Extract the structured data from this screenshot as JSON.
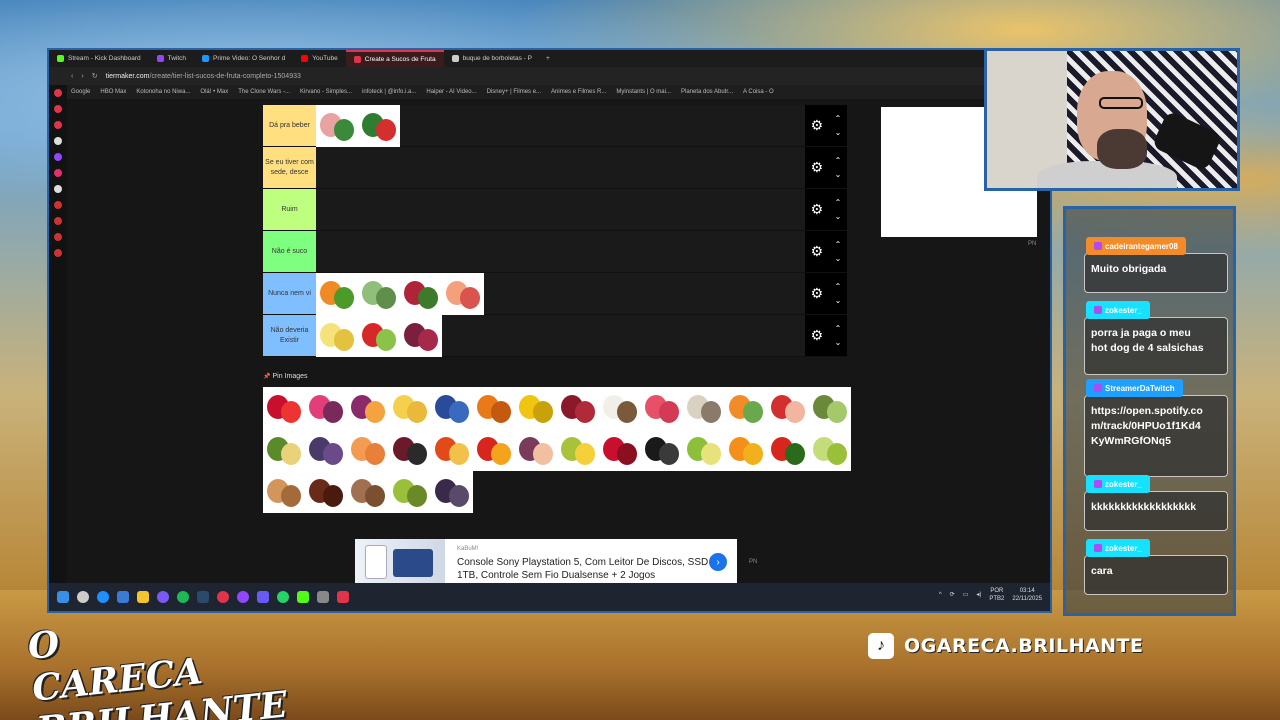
{
  "browser": {
    "tabs": [
      {
        "label": "Stream - Kick Dashboard",
        "color": "#53fc18",
        "active": false
      },
      {
        "label": "Twitch",
        "color": "#9146ff",
        "active": false
      },
      {
        "label": "Prime Video: O Senhor d",
        "color": "#1a98ff",
        "active": false
      },
      {
        "label": "YouTube",
        "color": "#ff0000",
        "active": false
      },
      {
        "label": "Create a Sucos de Fruta",
        "color": "#e0344a",
        "active": true
      },
      {
        "label": "buque de borboletas - P",
        "color": "#cccccc",
        "active": false
      }
    ],
    "url_host": "tiermaker.com",
    "url_path": "/create/tier-list-sucos-de-fruta-completo-1504933",
    "bookmarks": [
      "Google",
      "HBO Max",
      "Kotonoha no Niwa...",
      "Olá! • Max",
      "The Clone Wars -...",
      "Kirvano - Simples...",
      "infoteck | @info.i.a...",
      "Haiper - AI Video...",
      "Disney+ | Filmes e...",
      "Animes e Filmes R...",
      "Myinstants | O mai...",
      "Planeta dos Abutr...",
      "A Coisa - O"
    ]
  },
  "tiers": [
    {
      "label": "Dá pra beber",
      "color": "#ffdf7f",
      "fruits": [
        [
          "#e8a2a0",
          "#3a8a3a"
        ],
        [
          "#2e7d32",
          "#d32f2f"
        ]
      ]
    },
    {
      "label": "Se eu tiver com sede, desce",
      "color": "#ffdf7f",
      "fruits": []
    },
    {
      "label": "Ruim",
      "color": "#bfff7f",
      "fruits": []
    },
    {
      "label": "Não é suco",
      "color": "#7fff7f",
      "fruits": []
    },
    {
      "label": "Nunca nem vi",
      "color": "#7fbfff",
      "fruits": [
        [
          "#f08a24",
          "#4c9a2a"
        ],
        [
          "#8fbf7a",
          "#5f8f4a"
        ],
        [
          "#b0243a",
          "#3f7a2a"
        ],
        [
          "#f4a07a",
          "#d9534f"
        ]
      ]
    },
    {
      "label": "Não deveria Existir",
      "color": "#7fbfff",
      "fruits": [
        [
          "#f6e27a",
          "#e2c23f"
        ],
        [
          "#d62828",
          "#8bc34a"
        ],
        [
          "#7a1f3d",
          "#a52a4a"
        ]
      ]
    }
  ],
  "pin_images_label": "Pin Images",
  "pool": [
    [
      "#c8102e",
      "#e33"
    ],
    [
      "#e23f7a",
      "#7a2a5a"
    ],
    [
      "#8a2a6a",
      "#f4a340"
    ],
    [
      "#f6d04d",
      "#e9b93a"
    ],
    [
      "#2a4a9a",
      "#3a6ac0"
    ],
    [
      "#e87a1a",
      "#c45a10"
    ],
    [
      "#f1c40f",
      "#c9a10a"
    ],
    [
      "#8a1a2a",
      "#b02a3a"
    ],
    [
      "#f2efe8",
      "#7a5a3a"
    ],
    [
      "#e8506a",
      "#d23a56"
    ],
    [
      "#d9d2c3",
      "#8a7a6a"
    ],
    [
      "#f28c28",
      "#6aa84f"
    ],
    [
      "#d32f2f",
      "#f2b5a0"
    ],
    [
      "#6a8a3a",
      "#a5c96a"
    ],
    [
      "#5a8a2a",
      "#e9d27a"
    ],
    [
      "#4a3a6a",
      "#6a4a8a"
    ],
    [
      "#f49b52",
      "#e8803a"
    ],
    [
      "#6a1a2a",
      "#2a2a2a"
    ],
    [
      "#e34a1a",
      "#f2c14a"
    ],
    [
      "#d7261e",
      "#f4a31a"
    ],
    [
      "#7a3a5a",
      "#f2c0a0"
    ],
    [
      "#a8c23a",
      "#f4d03a"
    ],
    [
      "#c8102e",
      "#8a0f1f"
    ],
    [
      "#1a1a1a",
      "#3a3a3a"
    ],
    [
      "#8cbf3a",
      "#e8e27a"
    ],
    [
      "#f4901a",
      "#f2b01a"
    ],
    [
      "#d7261e",
      "#2a6a1a"
    ],
    [
      "#c5dc7a",
      "#9ac03a"
    ],
    [
      "#d2955a",
      "#a56a3a"
    ],
    [
      "#6a2a1a",
      "#4a1a0f"
    ],
    [
      "#a07050",
      "#7a5030"
    ],
    [
      "#9ac03a",
      "#6a8a2a"
    ],
    [
      "#3a2a4a",
      "#5a4a6a"
    ]
  ],
  "ads": {
    "pn_label": "PN",
    "bottom": {
      "source": "KaBuM!",
      "title": "Console Sony Playstation 5, Com Leitor De Discos, SSD 1TB, Controle Sem Fio Dualsense + 2 Jogos"
    }
  },
  "taskbar": {
    "lang1": "POR",
    "lang2": "PTB2",
    "time": "03:14",
    "date": "22/11/2025"
  },
  "chat": {
    "messages": [
      {
        "user": "cadeirantegamer08",
        "text": "Muito obrigada",
        "user_color": "#f28c28"
      },
      {
        "user": "zokester_",
        "text": "porra ja paga o meu\nhot dog de 4 salsichas",
        "user_color": "#18e0ff"
      },
      {
        "user": "StreamerDaTwitch",
        "text": "https://open.spotify.co\nm/track/0HPUo1f1Kd4\nKyWmRGfONq5",
        "user_color": "#1fa0ff"
      },
      {
        "user": "zokester_",
        "text": "kkkkkkkkkkkkkkkkkk",
        "user_color": "#18e0ff"
      },
      {
        "user": "zokester_",
        "text": "cara",
        "user_color": "#18e0ff"
      }
    ]
  },
  "branding": {
    "logo_line1": "O CARECA",
    "logo_line2": "BRILHANTE",
    "tiktok_handle": "OGARECA.BRILHANTE",
    "tiktok_icon": "tiktok-icon"
  }
}
